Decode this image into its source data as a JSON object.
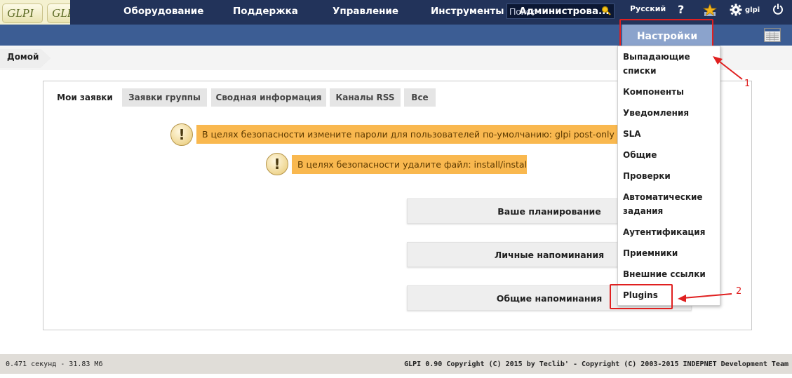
{
  "header": {
    "logo_text": "GLPI",
    "search_placeholder": "Поиск",
    "language": "Русский",
    "help_icon": "?",
    "user": "glpi"
  },
  "menu": {
    "items": [
      "Оборудование",
      "Поддержка",
      "Управление",
      "Инструменты",
      "Администрова..."
    ],
    "active": "Настройки"
  },
  "breadcrumb": {
    "home": "Домой"
  },
  "tabs": [
    "Мои заявки",
    "Заявки группы",
    "Сводная информация",
    "Каналы RSS",
    "Все"
  ],
  "warnings": [
    "В целях безопасности измените пароли для пользователей по-умолчанию: glpi post-only tech normal",
    "В целях безопасности удалите файл: install/install.php"
  ],
  "buttons": [
    "Ваше планирование",
    "Личные напоминания",
    "Общие напоминания"
  ],
  "dropdown": {
    "items": [
      "Выпадающие списки",
      "Компоненты",
      "Уведомления",
      "SLA",
      "Общие",
      "Проверки",
      "Автоматические задания",
      "Аутентификация",
      "Приемники",
      "Внешние ссылки",
      "Plugins"
    ]
  },
  "annotations": {
    "one": "1",
    "two": "2"
  },
  "footer": {
    "timing": "0.471 секунд - 31.83 Мб",
    "copyright": "GLPI 0.90 Copyright (C) 2015 by Teclib' - Copyright (C) 2003-2015 INDEPNET Development Team"
  }
}
